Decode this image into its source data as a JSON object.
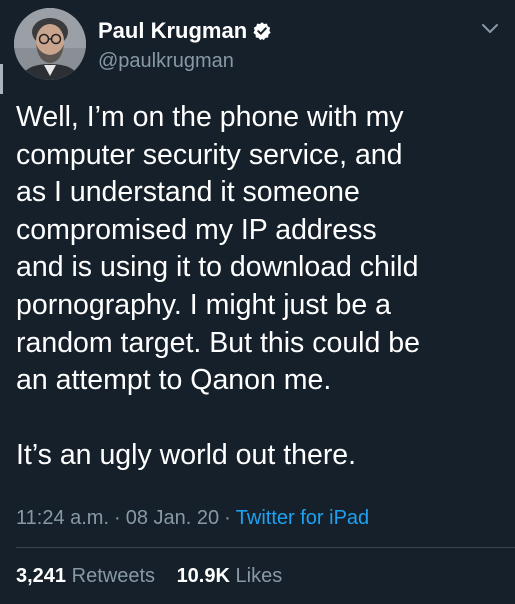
{
  "author": {
    "display_name": "Paul Krugman",
    "handle": "@paulkrugman",
    "verified": true
  },
  "tweet": {
    "lines": [
      "Well, I’m on the phone with my",
      "computer security service, and",
      "as I understand it someone",
      "compromised my IP address",
      "and is using it to download child",
      "pornography. I might just be a",
      "random target. But this could be",
      "an attempt to Qanon me."
    ],
    "closing_line": "It’s an ugly world out there."
  },
  "meta": {
    "time": "11:24 a.m.",
    "separator": "·",
    "date": "08 Jan. 20",
    "source": "Twitter for iPad"
  },
  "stats": {
    "retweets_count": "3,241",
    "retweets_label": "Retweets",
    "likes_count": "10.9K",
    "likes_label": "Likes"
  },
  "colors": {
    "background": "#15202b",
    "secondary_text": "#8899a6",
    "link": "#1da1f2",
    "divider": "#38444d"
  },
  "icons": {
    "verified": "verified-badge-icon",
    "menu": "chevron-down-icon"
  }
}
